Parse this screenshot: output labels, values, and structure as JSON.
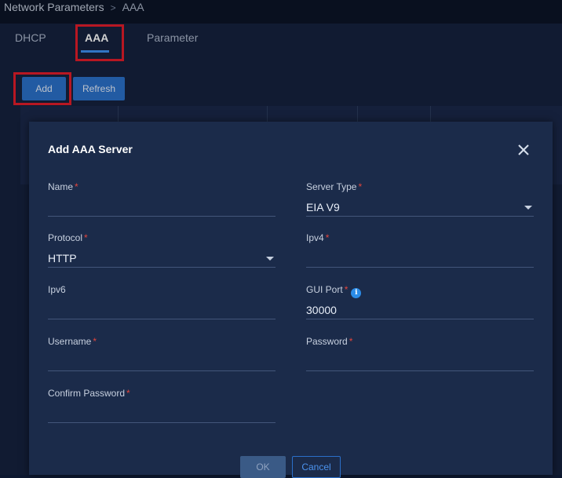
{
  "breadcrumb": {
    "parent": "Network Parameters",
    "separator": ">",
    "current": "AAA"
  },
  "tabs": [
    {
      "label": "DHCP",
      "active": false
    },
    {
      "label": "AAA",
      "active": true
    },
    {
      "label": "Parameter",
      "active": false
    }
  ],
  "toolbar": {
    "add_label": "Add",
    "refresh_label": "Refresh"
  },
  "modal": {
    "title": "Add AAA Server",
    "fields": {
      "name": {
        "label": "Name",
        "required": "*",
        "value": ""
      },
      "server_type": {
        "label": "Server Type",
        "required": "*",
        "value": "EIA V9"
      },
      "protocol": {
        "label": "Protocol",
        "required": "*",
        "value": "HTTP"
      },
      "ipv4": {
        "label": "Ipv4",
        "required": "*",
        "value": ""
      },
      "ipv6": {
        "label": "Ipv6",
        "value": ""
      },
      "gui_port": {
        "label": "GUI Port",
        "required": "*",
        "info_symbol": "i",
        "value": "30000"
      },
      "username": {
        "label": "Username",
        "required": "*",
        "value": ""
      },
      "password": {
        "label": "Password",
        "required": "*",
        "value": ""
      },
      "confirm_password": {
        "label": "Confirm Password",
        "required": "*",
        "value": ""
      }
    },
    "ok_label": "OK",
    "cancel_label": "Cancel"
  },
  "colors": {
    "accent": "#2a6fc7",
    "highlight": "#e11d2a",
    "required": "#e2453c",
    "background": "#15223d"
  }
}
